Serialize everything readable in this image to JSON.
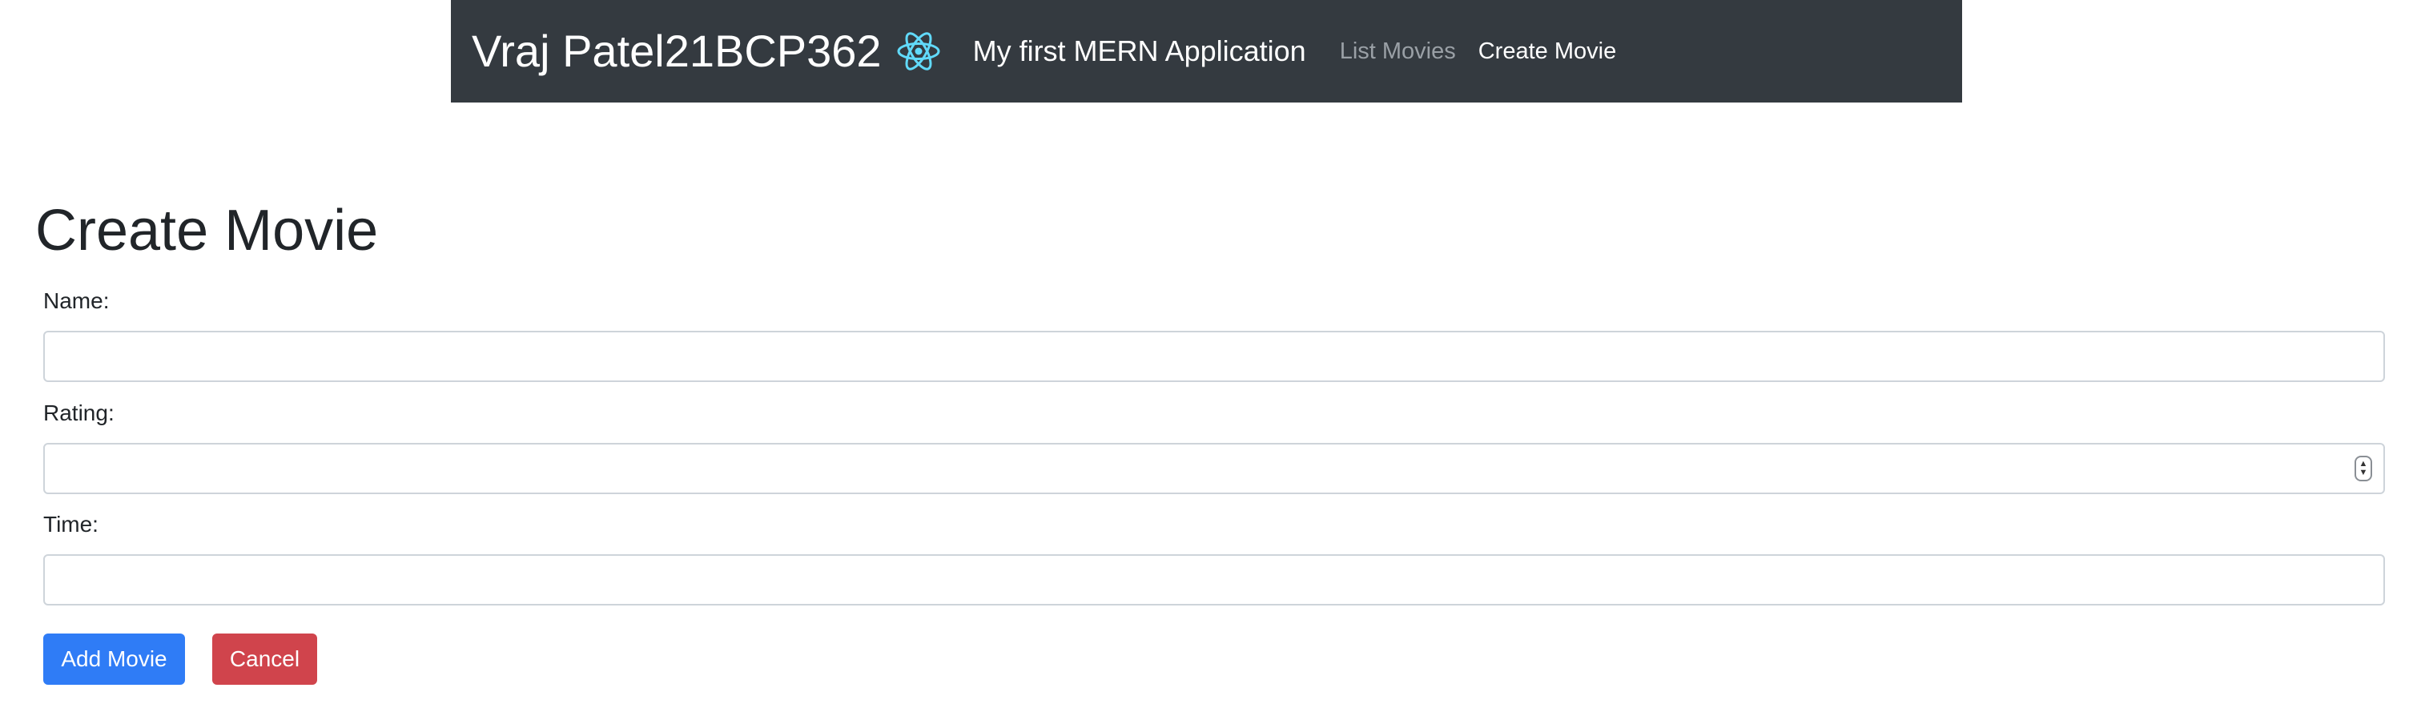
{
  "navbar": {
    "brand": "Vraj Patel21BCP362",
    "logo_icon": "react-logo-icon",
    "app_title": "My first MERN Application",
    "links": [
      {
        "label": "List Movies",
        "active": false
      },
      {
        "label": "Create Movie",
        "active": true
      }
    ]
  },
  "page": {
    "title": "Create Movie"
  },
  "form": {
    "name_label": "Name:",
    "name_value": "",
    "rating_label": "Rating:",
    "rating_value": "",
    "time_label": "Time:",
    "time_value": ""
  },
  "buttons": {
    "add_label": "Add Movie",
    "cancel_label": "Cancel"
  },
  "colors": {
    "navbar_bg": "#343a40",
    "primary": "#2f7cf6",
    "danger": "#d0444c",
    "react_logo": "#61dafb"
  }
}
